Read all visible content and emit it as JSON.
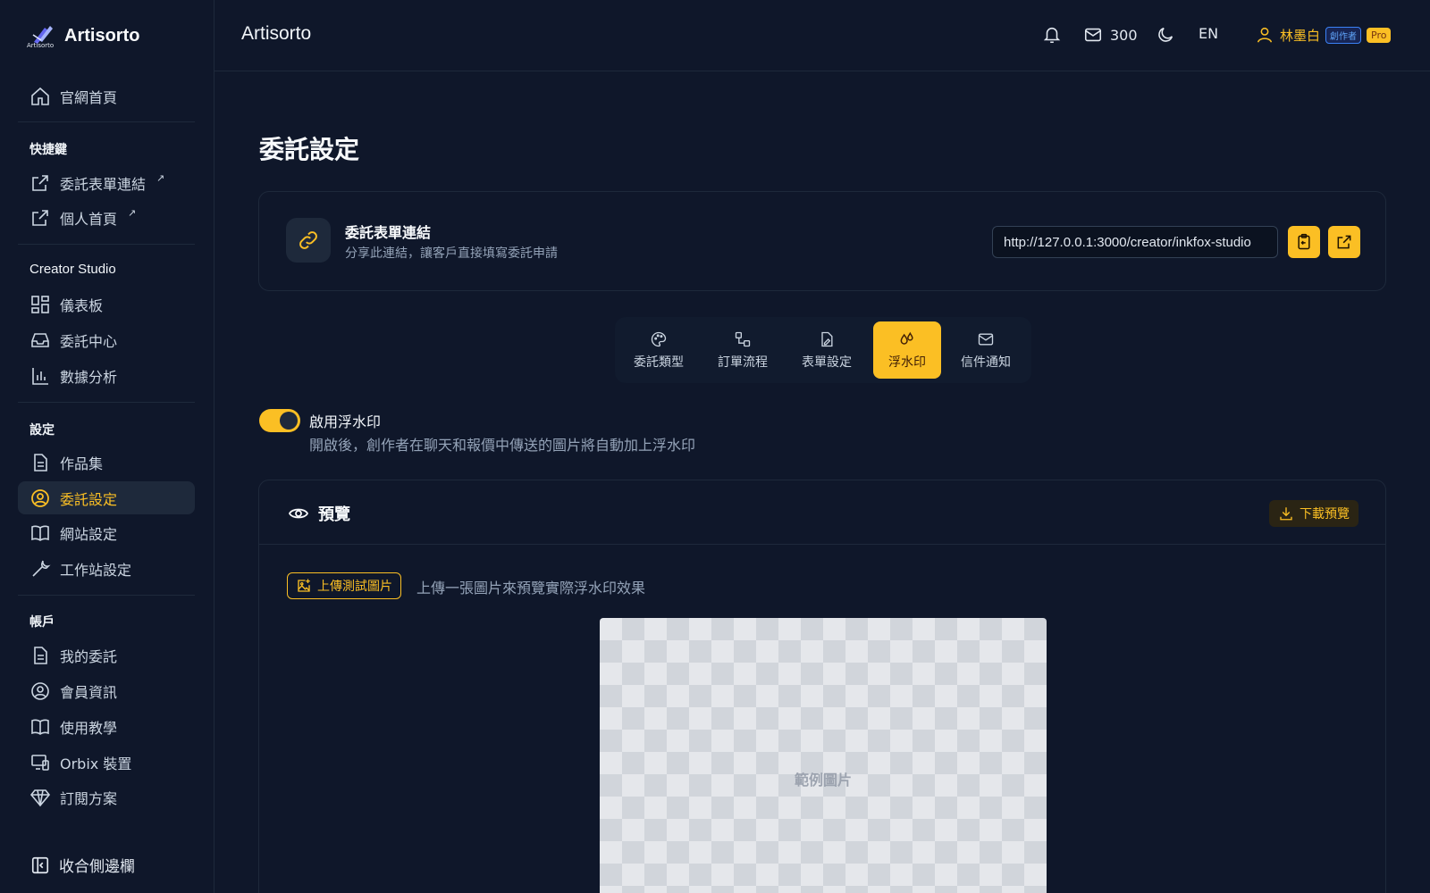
{
  "brand": {
    "name": "Artisorto",
    "logo_caption": "Artisorto"
  },
  "header": {
    "title": "Artisorto",
    "mail_count": "300",
    "language": "EN",
    "user_name": "林墨白",
    "role_badge": "創作者",
    "plan_badge": "Pro"
  },
  "sidebar": {
    "home": "官網首頁",
    "shortcuts_title": "快捷鍵",
    "shortcut_form_link": "委託表單連結",
    "shortcut_profile": "個人首頁",
    "studio_title": "Creator Studio",
    "dashboard": "儀表板",
    "commission_center": "委託中心",
    "analytics": "數據分析",
    "settings_title": "設定",
    "portfolio": "作品集",
    "commission_settings": "委託設定",
    "site_settings": "網站設定",
    "workspace_settings": "工作站設定",
    "account_title": "帳戶",
    "my_commissions": "我的委託",
    "member_info": "會員資訊",
    "tutorial": "使用教學",
    "orbix_devices": "Orbix 裝置",
    "subscription": "訂閱方案",
    "collapse": "收合側邊欄",
    "ext_mark": "↗"
  },
  "page": {
    "title": "委託設定",
    "link_card": {
      "title": "委託表單連結",
      "subtitle": "分享此連結，讓客戶直接填寫委託申請",
      "url": "http://127.0.0.1:3000/creator/inkfox-studio"
    },
    "tabs": [
      {
        "label": "委託類型"
      },
      {
        "label": "訂單流程"
      },
      {
        "label": "表單設定"
      },
      {
        "label": "浮水印"
      },
      {
        "label": "信件通知"
      }
    ],
    "active_tab": "浮水印",
    "watermark": {
      "enabled": true,
      "label": "啟用浮水印",
      "description": "開啟後，創作者在聊天和報價中傳送的圖片將自動加上浮水印"
    },
    "preview": {
      "title": "預覽",
      "download_label": "下載預覽",
      "upload_label": "上傳測試圖片",
      "upload_hint": "上傳一張圖片來預覽實際浮水印效果",
      "sample_label": "範例圖片"
    }
  },
  "colors": {
    "accent": "#fbbf24",
    "background": "#0f172a",
    "border": "#1e293b"
  }
}
